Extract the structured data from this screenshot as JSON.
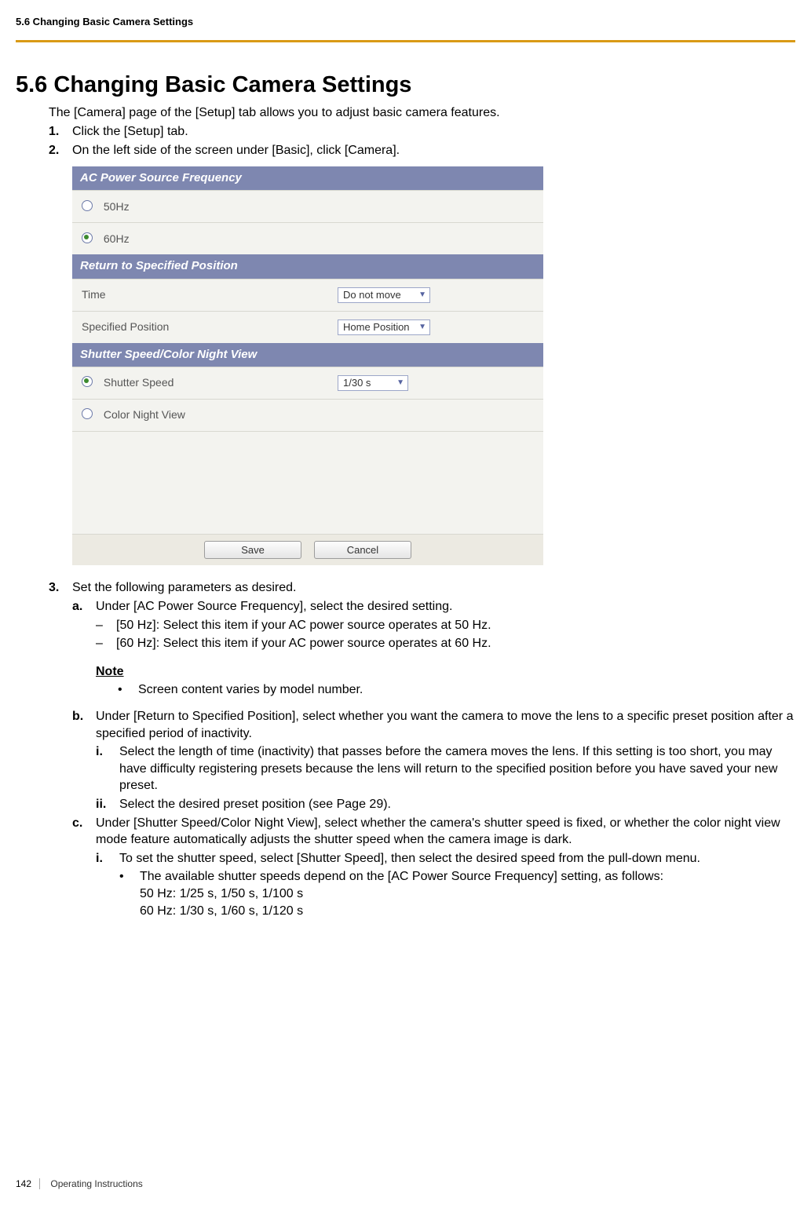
{
  "header": {
    "running": "5.6 Changing Basic Camera Settings"
  },
  "section": {
    "number_title": "5.6  Changing Basic Camera Settings",
    "intro": "The [Camera] page of the [Setup] tab allows you to adjust basic camera features.",
    "steps": {
      "s1": "Click the [Setup] tab.",
      "s2": "On the left side of the screen under [Basic], click [Camera].",
      "s3": "Set the following parameters as desired.",
      "s3a": "Under [AC Power Source Frequency], select the desired setting.",
      "s3a_d1": "[50 Hz]: Select this item if your AC power source operates at 50 Hz.",
      "s3a_d2": "[60 Hz]: Select this item if your AC power source operates at 60 Hz.",
      "note_label": "Note",
      "note_b1": "Screen content varies by model number.",
      "s3b": "Under [Return to Specified Position], select whether you want the camera to move the lens to a specific preset position after a specified period of inactivity.",
      "s3b_i": "Select the length of time (inactivity) that passes before the camera moves the lens. If this setting is too short, you may have difficulty registering presets because the lens will return to the specified position before you have saved your new preset.",
      "s3b_ii": "Select the desired preset position (see Page 29).",
      "s3c": "Under [Shutter Speed/Color Night View], select whether the camera's shutter speed is fixed, or whether the color night view mode feature automatically adjusts the shutter speed when the camera image is dark.",
      "s3c_i": "To set the shutter speed, select [Shutter Speed], then select the desired speed from the pull-down menu.",
      "s3c_i_b1": "The available shutter speeds depend on the [AC Power Source Frequency] setting, as follows:",
      "s3c_i_l1": "50 Hz: 1/25 s, 1/50 s, 1/100 s",
      "s3c_i_l2": "60 Hz: 1/30 s, 1/60 s, 1/120 s"
    }
  },
  "panel": {
    "sec1_title": "AC Power Source Frequency",
    "opt_50": "50Hz",
    "opt_60": "60Hz",
    "sec2_title": "Return to Specified Position",
    "row_time_label": "Time",
    "row_time_value": "Do not move",
    "row_pos_label": "Specified Position",
    "row_pos_value": "Home Position",
    "sec3_title": "Shutter Speed/Color Night View",
    "opt_shutter": "Shutter Speed",
    "opt_shutter_value": "1/30 s",
    "opt_night": "Color Night View",
    "btn_save": "Save",
    "btn_cancel": "Cancel"
  },
  "footer": {
    "page_number": "142",
    "doc_title": "Operating Instructions"
  }
}
